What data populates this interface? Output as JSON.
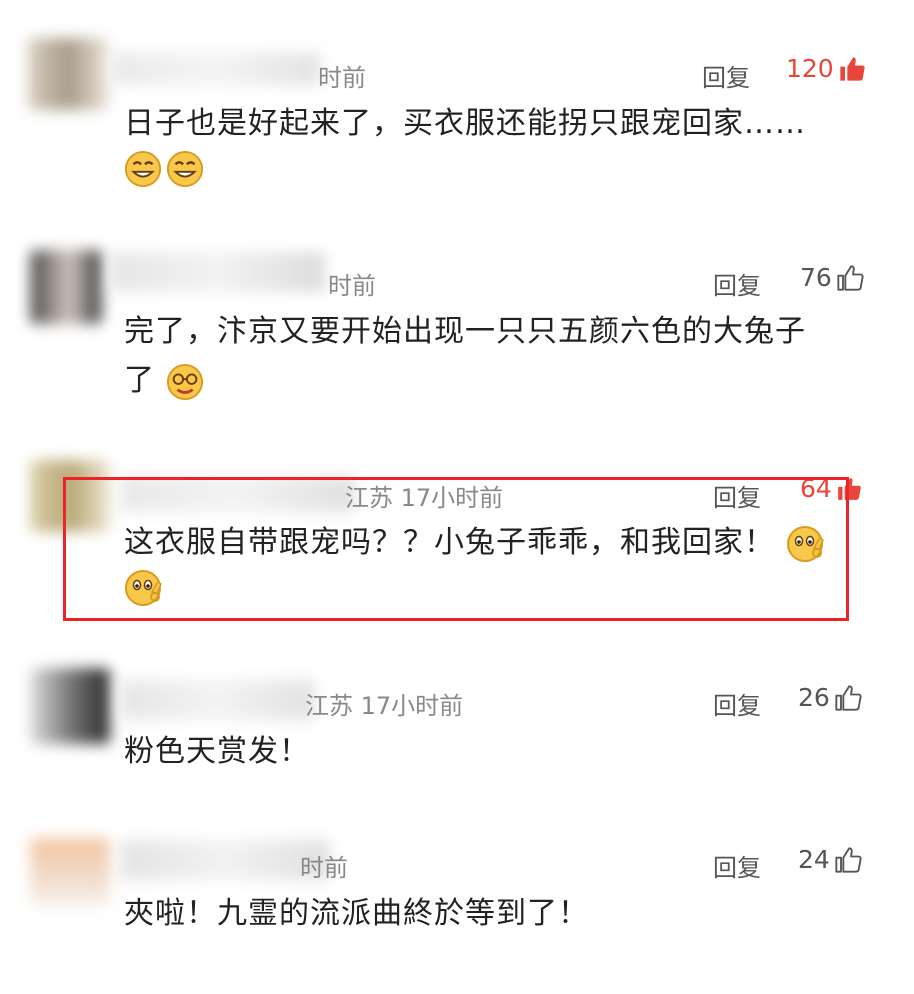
{
  "comments": [
    {
      "time": "时前",
      "reply_label": "回复",
      "likes": "120",
      "liked": true,
      "text": "日子也是好起来了，买衣服还能拐只跟宠回家……",
      "emojis": [
        "grin-emoji",
        "grin-emoji"
      ]
    },
    {
      "time": "时前",
      "reply_label": "回复",
      "likes": "76",
      "liked": false,
      "text_line1": "完了，汴京又要开始出现一只只五颜六色的大兔子",
      "text_line2": "了",
      "emojis": [
        "glasses-emoji"
      ]
    },
    {
      "time": "江苏 17小时前",
      "reply_label": "回复",
      "likes": "64",
      "liked": true,
      "text": "这衣服自带跟宠吗？？小兔子乖乖，和我回家！",
      "emojis": [
        "ok-hand-emoji",
        "ok-hand-emoji"
      ]
    },
    {
      "time": "江苏 17小时前",
      "reply_label": "回复",
      "likes": "26",
      "liked": false,
      "text": "粉色天赏发！"
    },
    {
      "time": "时前",
      "reply_label": "回复",
      "likes": "24",
      "liked": false,
      "text": "夾啦！九霊的流派曲終於等到了！"
    }
  ],
  "colors": {
    "highlight": "#e9252b",
    "like_active": "#e8463a",
    "meta_text": "#888888"
  }
}
